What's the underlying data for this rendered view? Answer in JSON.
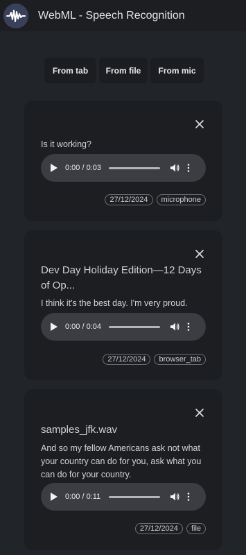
{
  "header": {
    "title": "WebML - Speech Recognition",
    "logo_icon": "waveform-icon"
  },
  "sources": [
    "From tab",
    "From file",
    "From mic"
  ],
  "cards": [
    {
      "title": "",
      "text": "Is it working?",
      "time": "0:00 / 0:03",
      "date": "27/12/2024",
      "source": "microphone"
    },
    {
      "title": "Dev Day Holiday Edition—12 Days of Op...",
      "text": "I think it's the best day. I'm very proud.",
      "time": "0:00 / 0:04",
      "date": "27/12/2024",
      "source": "browser_tab"
    },
    {
      "title": "samples_jfk.wav",
      "text": "And so my fellow Americans ask not what your country can do for you, ask what you can do for your country.",
      "time": "0:00 / 0:11",
      "date": "27/12/2024",
      "source": "file"
    }
  ],
  "colors": {
    "background": "#212429",
    "card": "#1c1e22",
    "player": "#3b3d42"
  }
}
